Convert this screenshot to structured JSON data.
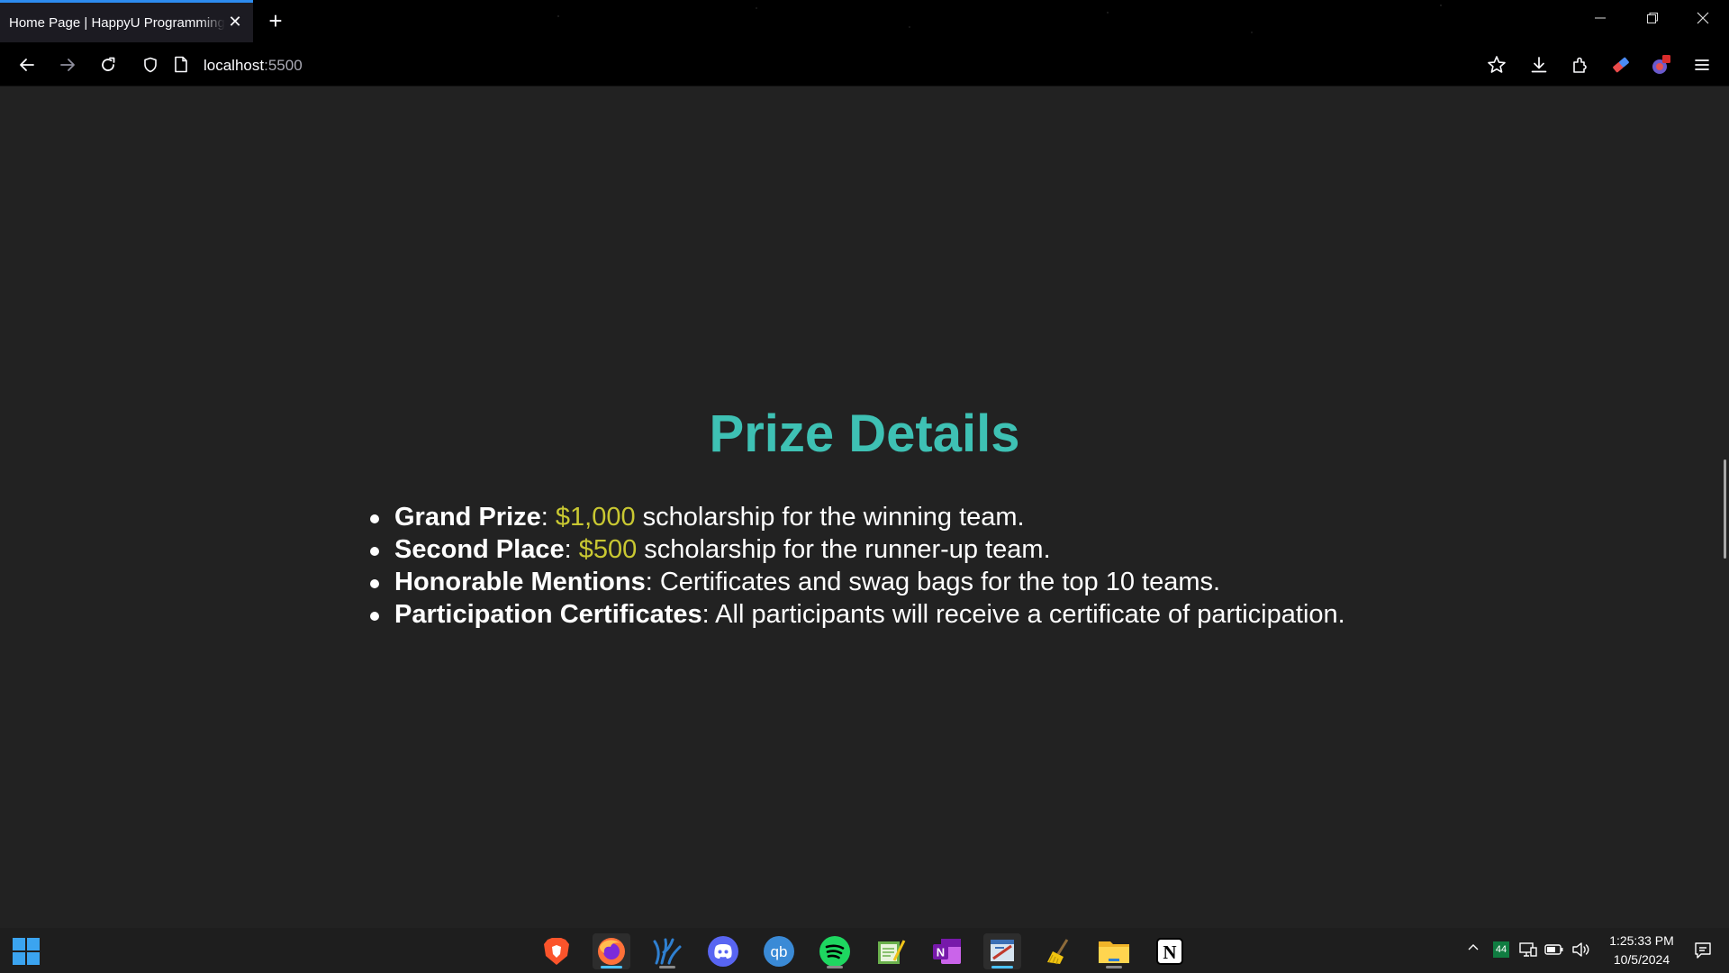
{
  "browser": {
    "tab_title": "Home Page | HappyU Programming",
    "tab_close": "✕",
    "new_tab": "+",
    "url_host": "localhost",
    "url_port": ":5500",
    "accent": "#2d8cf0"
  },
  "page": {
    "heading": "Prize Details",
    "heading_color": "#3ec1b4",
    "amount_color": "#c9c832",
    "prizes": [
      {
        "title": "Grand Prize",
        "sep": ": ",
        "amount": "$1,000",
        "text": " scholarship for the winning team."
      },
      {
        "title": "Second Place",
        "sep": ": ",
        "amount": "$500",
        "text": " scholarship for the runner-up team."
      },
      {
        "title": "Honorable Mentions",
        "sep": ": ",
        "text": "Certificates and swag bags for the top 10 teams."
      },
      {
        "title": "Participation Certificates",
        "sep": ": ",
        "text": "All participants will receive a certificate of participation."
      }
    ]
  },
  "taskbar": {
    "apps": [
      "brave-icon",
      "firefox-icon",
      "vscodium-icon",
      "discord-icon",
      "qbittorrent-icon",
      "spotify-icon",
      "notepad-icon",
      "onenote-icon",
      "paint-icon",
      "cleaner-icon",
      "file-explorer-icon",
      "notion-icon"
    ],
    "tray_badge": "44",
    "time": "1:25:33 PM",
    "date": "10/5/2024"
  }
}
